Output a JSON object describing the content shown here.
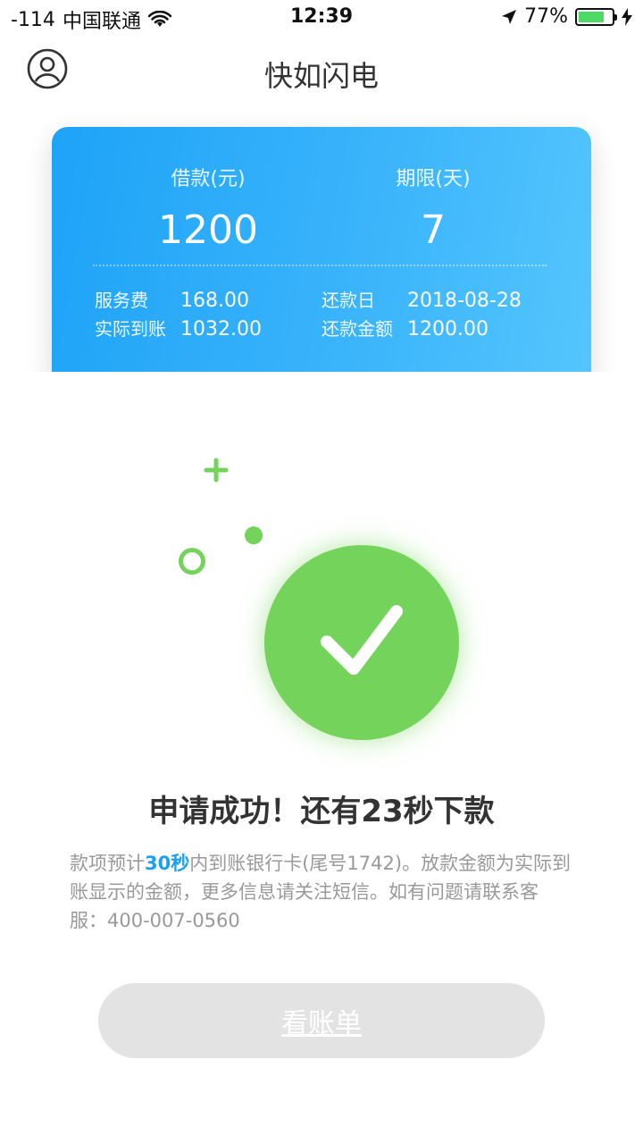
{
  "status_bar": {
    "signal": "-114",
    "carrier": "中国联通",
    "time": "12:39",
    "battery_percent": "77%",
    "battery_level": 0.77
  },
  "nav": {
    "title": "快如闪电",
    "avatar_icon": "user-circle-icon"
  },
  "loan_card": {
    "amount_label": "借款(元)",
    "amount_value": "1200",
    "term_label": "期限(天)",
    "term_value": "7",
    "details": {
      "service_fee_label": "服务费",
      "service_fee_value": "168.00",
      "actual_received_label": "实际到账",
      "actual_received_value": "1032.00",
      "repay_date_label": "还款日",
      "repay_date_value": "2018-08-28",
      "repay_amount_label": "还款金额",
      "repay_amount_value": "1200.00"
    },
    "colors": {
      "gradient_start": "#1ea3f7",
      "gradient_end": "#55c6fd"
    }
  },
  "result": {
    "icon": "checkmark-icon",
    "title": "申请成功！还有23秒下款",
    "info_prefix": "款项预计",
    "info_highlight": "30秒",
    "info_rest": "内到账银行卡(尾号1742)。放款金额为实际到账显示的金额，更多信息请关注短信。如有问题请联系客服：400-007-0560",
    "accent_color": "#74d35a",
    "highlight_color": "#1d9ff0"
  },
  "actions": {
    "view_bill_label": "看账单"
  }
}
